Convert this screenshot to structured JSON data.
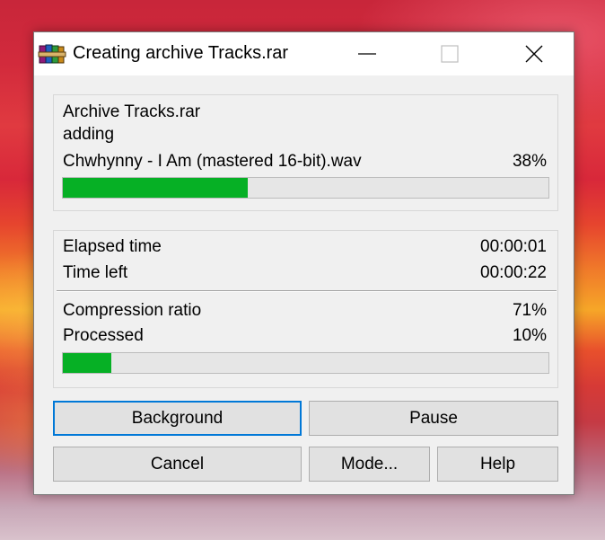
{
  "window": {
    "title": "Creating archive Tracks.rar",
    "icon": "winrar-books-icon"
  },
  "titlebar_buttons": [
    "minimize-icon",
    "maximize-icon",
    "close-icon"
  ],
  "progress_group": {
    "archive_line": "Archive Tracks.rar",
    "action": "adding",
    "current_file": "Chwhynny - I Am (mastered 16-bit).wav",
    "file_percent_text": "38%",
    "file_progress": 0.38
  },
  "stats_group": {
    "elapsed_label": "Elapsed time",
    "elapsed_value": "00:00:01",
    "time_left_label": "Time left",
    "time_left_value": "00:00:22",
    "ratio_label": "Compression ratio",
    "ratio_value": "71%",
    "processed_label": "Processed",
    "processed_value": "10%",
    "processed_progress": 0.1
  },
  "buttons": {
    "background": "Background",
    "pause": "Pause",
    "cancel": "Cancel",
    "mode": "Mode...",
    "help": "Help"
  },
  "colors": {
    "progress_fill": "#06b025",
    "focus_border": "#0078d7"
  }
}
